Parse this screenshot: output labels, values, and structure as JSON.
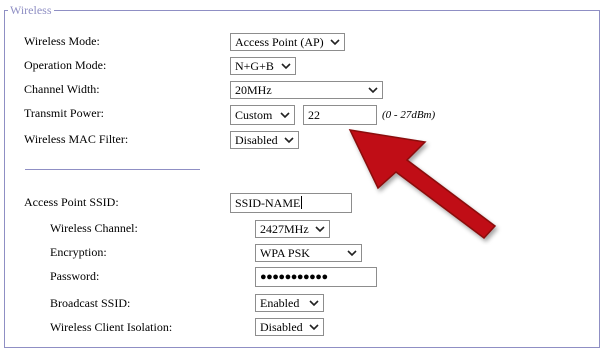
{
  "section": {
    "legend": "Wireless"
  },
  "fields": {
    "wireless_mode": {
      "label": "Wireless Mode:",
      "value": "Access Point (AP)"
    },
    "operation_mode": {
      "label": "Operation Mode:",
      "value": "N+G+B"
    },
    "channel_width": {
      "label": "Channel Width:",
      "value": "20MHz"
    },
    "transmit_power": {
      "label": "Transmit Power:",
      "mode": "Custom",
      "value": "22",
      "hint": "(0 - 27dBm)"
    },
    "mac_filter": {
      "label": "Wireless MAC Filter:",
      "value": "Disabled"
    },
    "ssid": {
      "label": "Access Point SSID:",
      "value": "SSID-NAME"
    },
    "channel": {
      "label": "Wireless Channel:",
      "value": "2427MHz"
    },
    "encryption": {
      "label": "Encryption:",
      "value": "WPA PSK"
    },
    "password": {
      "label": "Password:",
      "value": "●●●●●●●●●●●"
    },
    "broadcast_ssid": {
      "label": "Broadcast SSID:",
      "value": "Enabled"
    },
    "client_isolation": {
      "label": "Wireless Client Isolation:",
      "value": "Disabled"
    }
  },
  "colors": {
    "fieldset_border": "#8f8fc4",
    "arrow": "#c00d12"
  },
  "icons": {
    "dropdown": "chevron-down-icon",
    "annotation": "red-arrow-icon"
  }
}
